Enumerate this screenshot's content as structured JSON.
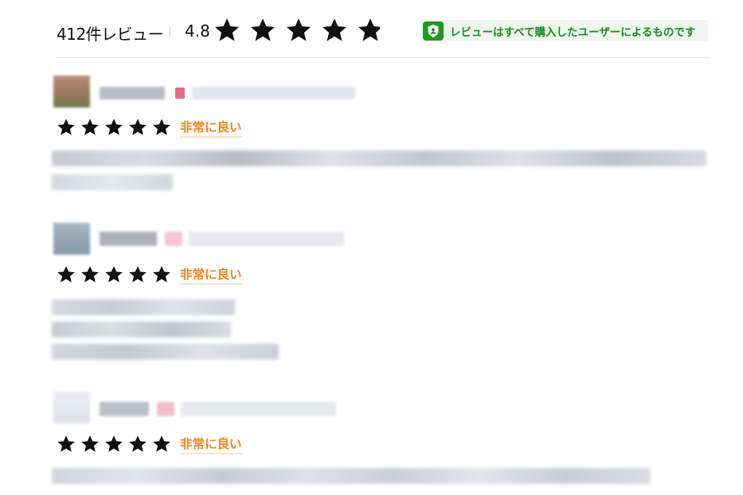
{
  "header": {
    "review_count": "412件レビュー",
    "average_rating": "4.8",
    "stars": 4.8,
    "verified_badge_text": "レビューはすべて購入したユーザーによるものです",
    "verified_icon": "verified-user-shield-icon",
    "badge_color": "#1f9a1f"
  },
  "reviews": [
    {
      "stars": 5,
      "rating_label": "非常に良い"
    },
    {
      "stars": 5,
      "rating_label": "非常に良い"
    },
    {
      "stars": 5,
      "rating_label": "非常に良い"
    }
  ],
  "colors": {
    "star": "#111111",
    "rating_label": "#f0841b",
    "badge_bg": "#eef7ec",
    "badge_text": "#1c8a1c"
  }
}
